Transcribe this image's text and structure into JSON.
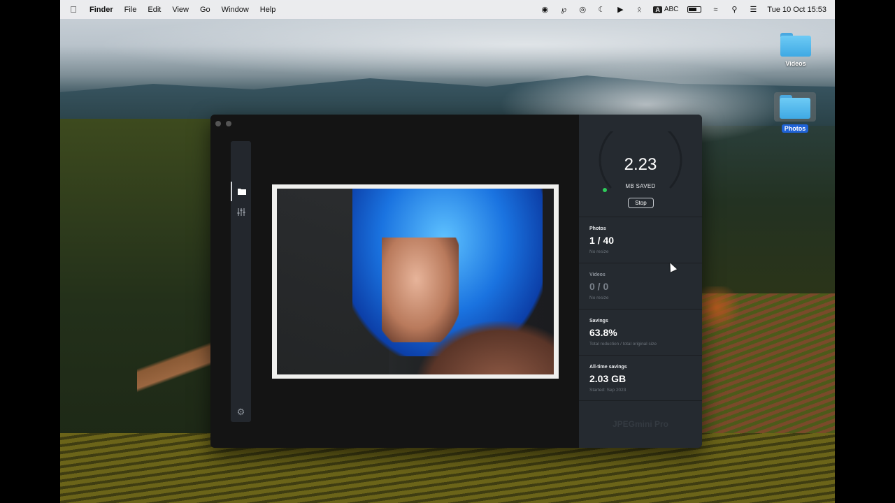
{
  "menubar": {
    "app_name": "Finder",
    "items": [
      "File",
      "Edit",
      "View",
      "Go",
      "Window",
      "Help"
    ],
    "input_source": "ABC",
    "input_badge": "A",
    "datetime": "Tue 10 Oct  15:53"
  },
  "desktop": {
    "icons": [
      {
        "label": "Videos",
        "selected": false
      },
      {
        "label": "Photos",
        "selected": true
      }
    ]
  },
  "app": {
    "gauge": {
      "value": "2.23",
      "unit": "MB SAVED",
      "stop_label": "Stop"
    },
    "stats": {
      "photos": {
        "label": "Photos",
        "value": "1 / 40",
        "sub": "No resize"
      },
      "videos": {
        "label": "Videos",
        "value": "0 / 0",
        "sub": "No resize"
      },
      "savings": {
        "label": "Savings",
        "value": "63.8%",
        "sub": "Total reduction / total original size"
      },
      "alltime": {
        "label": "All-time savings",
        "value": "2.03 GB",
        "sub": "Started: Sep 2023"
      }
    },
    "brand": "JPEGmini Pro",
    "rail_icons": [
      "folder-icon",
      "sliders-icon",
      "gear-icon"
    ]
  },
  "colors": {
    "accent_green": "#2ecc5a",
    "selection_blue": "#1f62d6",
    "panel": "#252a30"
  }
}
